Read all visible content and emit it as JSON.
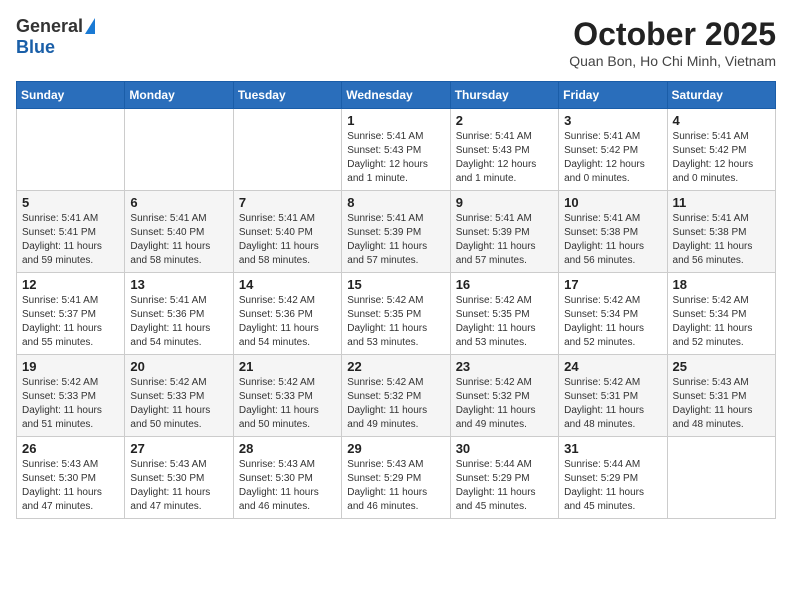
{
  "header": {
    "logo_general": "General",
    "logo_blue": "Blue",
    "month_title": "October 2025",
    "location": "Quan Bon, Ho Chi Minh, Vietnam"
  },
  "days_of_week": [
    "Sunday",
    "Monday",
    "Tuesday",
    "Wednesday",
    "Thursday",
    "Friday",
    "Saturday"
  ],
  "weeks": [
    [
      {
        "day": "",
        "info": ""
      },
      {
        "day": "",
        "info": ""
      },
      {
        "day": "",
        "info": ""
      },
      {
        "day": "1",
        "info": "Sunrise: 5:41 AM\nSunset: 5:43 PM\nDaylight: 12 hours\nand 1 minute."
      },
      {
        "day": "2",
        "info": "Sunrise: 5:41 AM\nSunset: 5:43 PM\nDaylight: 12 hours\nand 1 minute."
      },
      {
        "day": "3",
        "info": "Sunrise: 5:41 AM\nSunset: 5:42 PM\nDaylight: 12 hours\nand 0 minutes."
      },
      {
        "day": "4",
        "info": "Sunrise: 5:41 AM\nSunset: 5:42 PM\nDaylight: 12 hours\nand 0 minutes."
      }
    ],
    [
      {
        "day": "5",
        "info": "Sunrise: 5:41 AM\nSunset: 5:41 PM\nDaylight: 11 hours\nand 59 minutes."
      },
      {
        "day": "6",
        "info": "Sunrise: 5:41 AM\nSunset: 5:40 PM\nDaylight: 11 hours\nand 58 minutes."
      },
      {
        "day": "7",
        "info": "Sunrise: 5:41 AM\nSunset: 5:40 PM\nDaylight: 11 hours\nand 58 minutes."
      },
      {
        "day": "8",
        "info": "Sunrise: 5:41 AM\nSunset: 5:39 PM\nDaylight: 11 hours\nand 57 minutes."
      },
      {
        "day": "9",
        "info": "Sunrise: 5:41 AM\nSunset: 5:39 PM\nDaylight: 11 hours\nand 57 minutes."
      },
      {
        "day": "10",
        "info": "Sunrise: 5:41 AM\nSunset: 5:38 PM\nDaylight: 11 hours\nand 56 minutes."
      },
      {
        "day": "11",
        "info": "Sunrise: 5:41 AM\nSunset: 5:38 PM\nDaylight: 11 hours\nand 56 minutes."
      }
    ],
    [
      {
        "day": "12",
        "info": "Sunrise: 5:41 AM\nSunset: 5:37 PM\nDaylight: 11 hours\nand 55 minutes."
      },
      {
        "day": "13",
        "info": "Sunrise: 5:41 AM\nSunset: 5:36 PM\nDaylight: 11 hours\nand 54 minutes."
      },
      {
        "day": "14",
        "info": "Sunrise: 5:42 AM\nSunset: 5:36 PM\nDaylight: 11 hours\nand 54 minutes."
      },
      {
        "day": "15",
        "info": "Sunrise: 5:42 AM\nSunset: 5:35 PM\nDaylight: 11 hours\nand 53 minutes."
      },
      {
        "day": "16",
        "info": "Sunrise: 5:42 AM\nSunset: 5:35 PM\nDaylight: 11 hours\nand 53 minutes."
      },
      {
        "day": "17",
        "info": "Sunrise: 5:42 AM\nSunset: 5:34 PM\nDaylight: 11 hours\nand 52 minutes."
      },
      {
        "day": "18",
        "info": "Sunrise: 5:42 AM\nSunset: 5:34 PM\nDaylight: 11 hours\nand 52 minutes."
      }
    ],
    [
      {
        "day": "19",
        "info": "Sunrise: 5:42 AM\nSunset: 5:33 PM\nDaylight: 11 hours\nand 51 minutes."
      },
      {
        "day": "20",
        "info": "Sunrise: 5:42 AM\nSunset: 5:33 PM\nDaylight: 11 hours\nand 50 minutes."
      },
      {
        "day": "21",
        "info": "Sunrise: 5:42 AM\nSunset: 5:33 PM\nDaylight: 11 hours\nand 50 minutes."
      },
      {
        "day": "22",
        "info": "Sunrise: 5:42 AM\nSunset: 5:32 PM\nDaylight: 11 hours\nand 49 minutes."
      },
      {
        "day": "23",
        "info": "Sunrise: 5:42 AM\nSunset: 5:32 PM\nDaylight: 11 hours\nand 49 minutes."
      },
      {
        "day": "24",
        "info": "Sunrise: 5:42 AM\nSunset: 5:31 PM\nDaylight: 11 hours\nand 48 minutes."
      },
      {
        "day": "25",
        "info": "Sunrise: 5:43 AM\nSunset: 5:31 PM\nDaylight: 11 hours\nand 48 minutes."
      }
    ],
    [
      {
        "day": "26",
        "info": "Sunrise: 5:43 AM\nSunset: 5:30 PM\nDaylight: 11 hours\nand 47 minutes."
      },
      {
        "day": "27",
        "info": "Sunrise: 5:43 AM\nSunset: 5:30 PM\nDaylight: 11 hours\nand 47 minutes."
      },
      {
        "day": "28",
        "info": "Sunrise: 5:43 AM\nSunset: 5:30 PM\nDaylight: 11 hours\nand 46 minutes."
      },
      {
        "day": "29",
        "info": "Sunrise: 5:43 AM\nSunset: 5:29 PM\nDaylight: 11 hours\nand 46 minutes."
      },
      {
        "day": "30",
        "info": "Sunrise: 5:44 AM\nSunset: 5:29 PM\nDaylight: 11 hours\nand 45 minutes."
      },
      {
        "day": "31",
        "info": "Sunrise: 5:44 AM\nSunset: 5:29 PM\nDaylight: 11 hours\nand 45 minutes."
      },
      {
        "day": "",
        "info": ""
      }
    ]
  ]
}
